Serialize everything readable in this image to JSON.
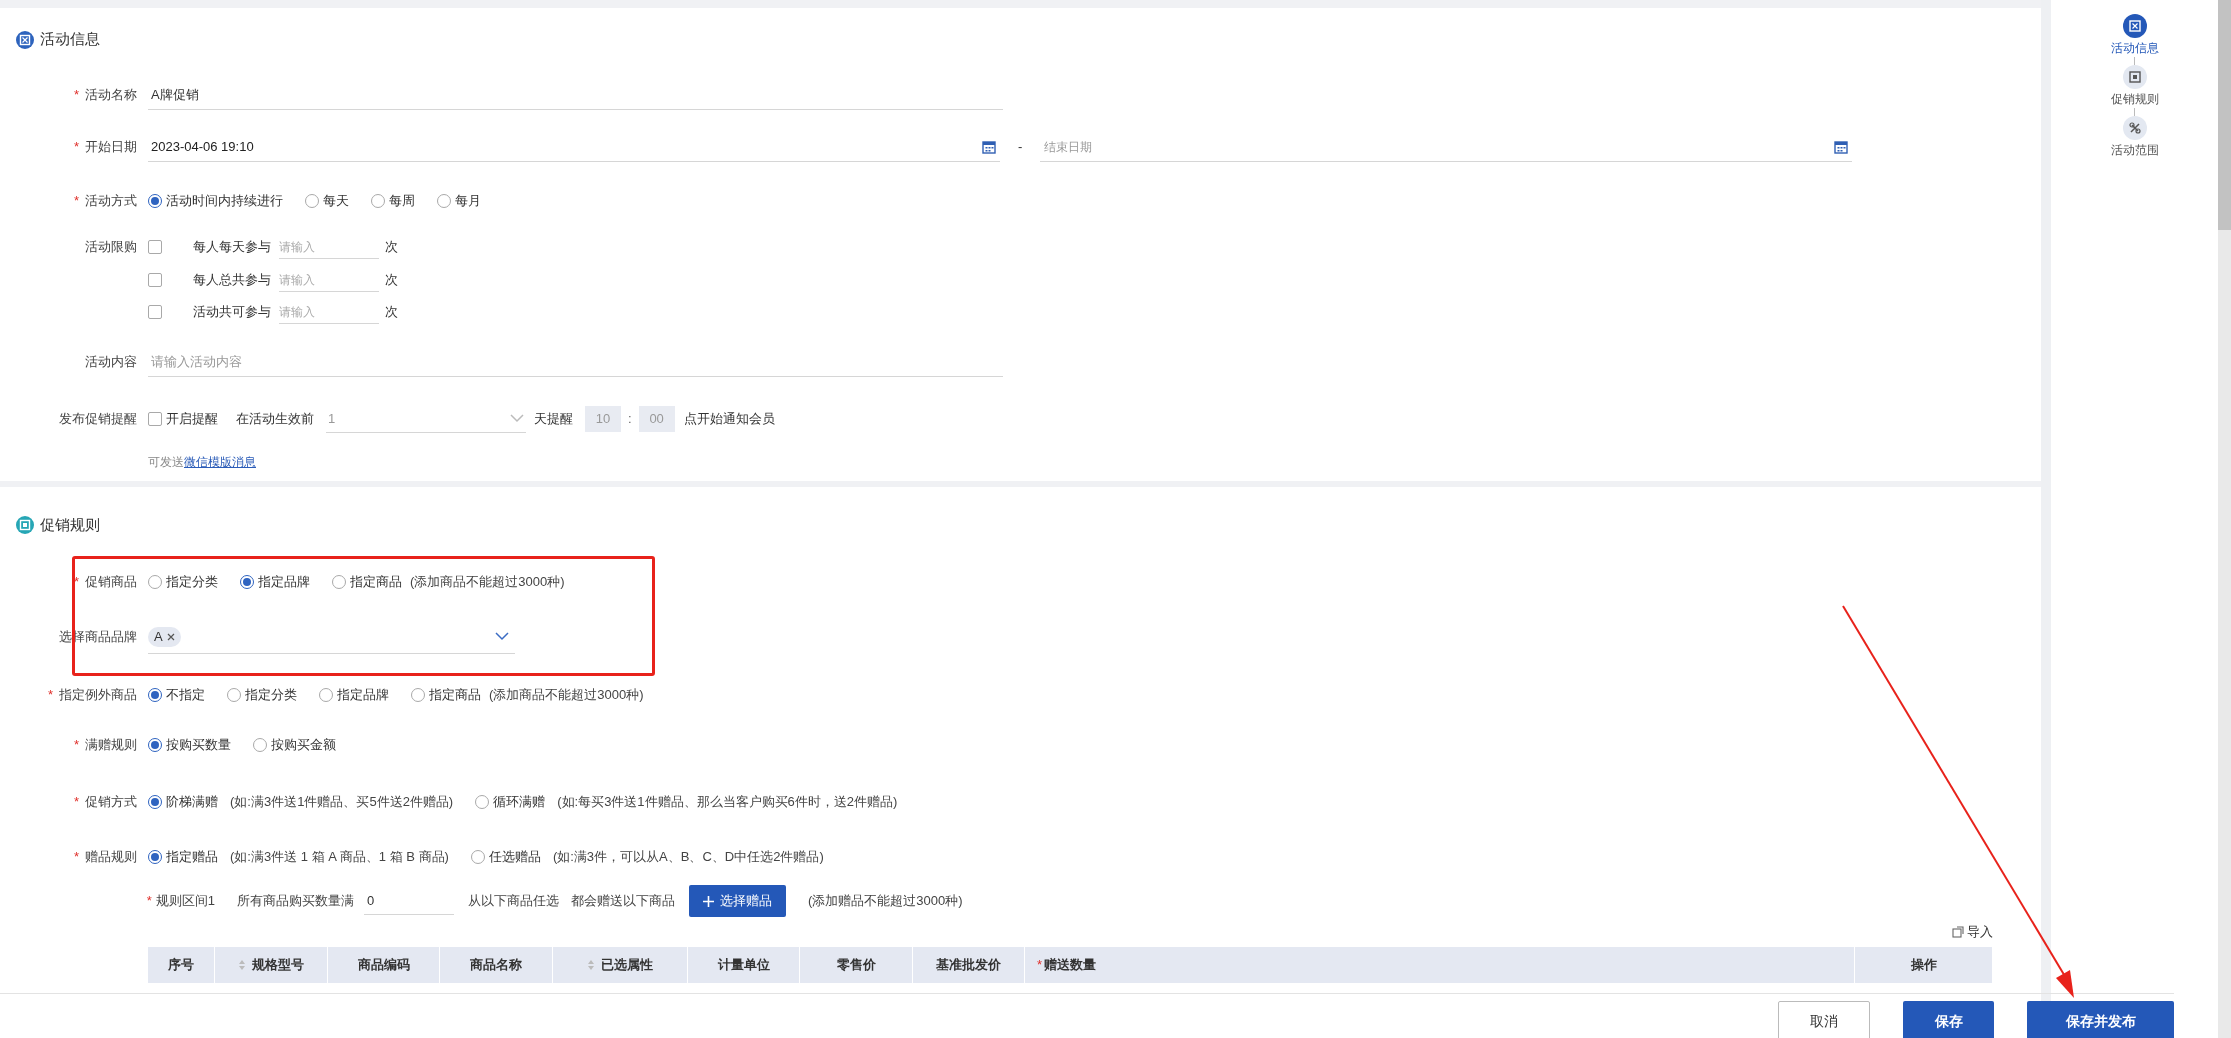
{
  "sections": [
    {
      "title": "活动信息",
      "rows": [
        {
          "kind": "text",
          "label": "活动名称",
          "required": true,
          "value": "A牌促销"
        },
        {
          "kind": "daterange",
          "label": "开始日期",
          "required": true,
          "value": "2023-04-06 19:10",
          "separator": "-",
          "end_placeholder": "结束日期"
        },
        {
          "kind": "radio",
          "label": "活动方式",
          "required": true,
          "options": [
            {
              "label": "活动时间内持续进行",
              "selected": true
            },
            {
              "label": "每天",
              "selected": false
            },
            {
              "label": "每周",
              "selected": false
            },
            {
              "label": "每月",
              "selected": false
            }
          ]
        },
        {
          "kind": "limits",
          "label": "活动限购",
          "required": false,
          "items": [
            {
              "label": "每人每天参与",
              "checked": false,
              "placeholder": "请输入",
              "unit": "次"
            },
            {
              "label": "每人总共参与",
              "checked": false,
              "placeholder": "请输入",
              "unit": "次"
            },
            {
              "label": "活动共可参与",
              "checked": false,
              "placeholder": "请输入",
              "unit": "次"
            }
          ]
        },
        {
          "kind": "textarea",
          "label": "活动内容",
          "required": false,
          "placeholder": "请输入活动内容"
        },
        {
          "kind": "reminder",
          "label": "发布促销提醒",
          "required": false,
          "checkbox": {
            "label": "开启提醒",
            "checked": false
          },
          "before": "在活动生效前",
          "days": "1",
          "days_unit": "天提醒",
          "hour": "10",
          "colon": ":",
          "minute": "00",
          "after": "点开始通知会员"
        },
        {
          "kind": "note",
          "text": "可发送",
          "link": "微信模版消息"
        }
      ]
    },
    {
      "title": "促销规则",
      "rows": [
        {
          "kind": "radio",
          "label": "促销商品",
          "required": true,
          "options": [
            {
              "label": "指定分类",
              "selected": false
            },
            {
              "label": "指定品牌",
              "selected": true
            },
            {
              "label": "指定商品",
              "selected": false
            }
          ],
          "note": "(添加商品不能超过3000种)"
        },
        {
          "kind": "tags",
          "label": "选择商品品牌",
          "required": false,
          "tags": [
            "A"
          ]
        },
        {
          "kind": "radio",
          "label": "指定例外商品",
          "required": true,
          "options": [
            {
              "label": "不指定",
              "selected": true
            },
            {
              "label": "指定分类",
              "selected": false
            },
            {
              "label": "指定品牌",
              "selected": false
            },
            {
              "label": "指定商品",
              "selected": false
            }
          ],
          "note": "(添加商品不能超过3000种)"
        },
        {
          "kind": "radio",
          "label": "满赠规则",
          "required": true,
          "options": [
            {
              "label": "按购买数量",
              "selected": true
            },
            {
              "label": "按购买金额",
              "selected": false
            }
          ]
        },
        {
          "kind": "radio",
          "label": "促销方式",
          "required": true,
          "options": [
            {
              "label": "阶梯满赠",
              "hint": "(如:满3件送1件赠品、买5件送2件赠品)",
              "selected": true
            },
            {
              "label": "循环满赠",
              "hint": "(如:每买3件送1件赠品、那么当客户购买6件时，送2件赠品)",
              "selected": false
            }
          ]
        },
        {
          "kind": "radio",
          "label": "赠品规则",
          "required": true,
          "options": [
            {
              "label": "指定赠品",
              "hint": "(如:满3件送 1 箱 A 商品、1 箱 B 商品)",
              "selected": true
            },
            {
              "label": "任选赠品",
              "hint": "(如:满3件，可以从A、B、C、D中任选2件赠品)",
              "selected": false
            }
          ]
        },
        {
          "kind": "range",
          "label": "规则区间1",
          "required": true,
          "text": "所有商品购买数量满",
          "value": "0",
          "text2": "从以下商品任选",
          "text3": "都会赠送以下商品",
          "button": "选择赠品",
          "note": "(添加赠品不能超过3000种)"
        }
      ]
    }
  ],
  "import": "导入",
  "table": {
    "columns": [
      {
        "label": "序号",
        "sortable": false,
        "required": false
      },
      {
        "label": "规格型号",
        "sortable": true,
        "required": false
      },
      {
        "label": "商品编码",
        "sortable": false,
        "required": false
      },
      {
        "label": "商品名称",
        "sortable": false,
        "required": false
      },
      {
        "label": "已选属性",
        "sortable": true,
        "required": false
      },
      {
        "label": "计量单位",
        "sortable": false,
        "required": false
      },
      {
        "label": "零售价",
        "sortable": false,
        "required": false
      },
      {
        "label": "基准批发价",
        "sortable": false,
        "required": false
      },
      {
        "label": "赠送数量",
        "sortable": false,
        "required": true
      },
      {
        "label": "操作",
        "sortable": false,
        "required": false
      }
    ]
  },
  "nav": [
    {
      "label": "活动信息",
      "selected": true
    },
    {
      "label": "促销规则",
      "selected": false
    },
    {
      "label": "活动范围",
      "selected": false
    }
  ],
  "buttons": [
    {
      "label": "取消",
      "kind": "secondary"
    },
    {
      "label": "保存",
      "kind": "primary"
    },
    {
      "label": "保存并发布",
      "kind": "primary"
    }
  ],
  "required_mark": "*",
  "annotations": {
    "highlight_box": true,
    "arrow": true
  }
}
